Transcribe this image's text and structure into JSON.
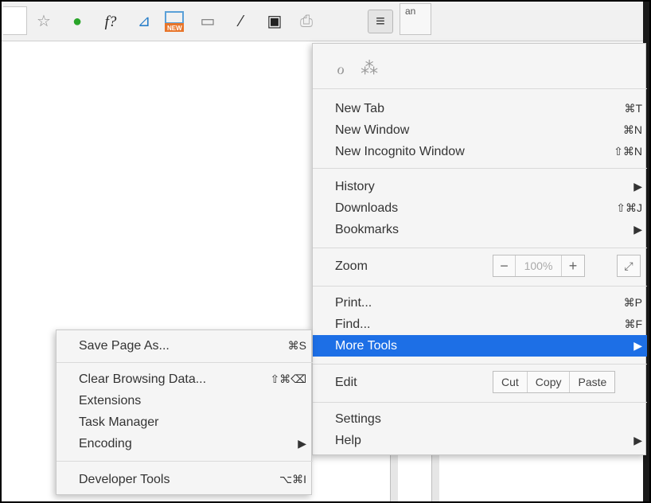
{
  "toolbar": {
    "icons": [
      "star-icon",
      "evernote-icon",
      "fx-icon",
      "satellite-icon",
      "new-badge-icon",
      "message-icon",
      "eyedropper-icon",
      "screenshot-icon",
      "print-icon",
      "menu-icon"
    ],
    "fx_label": "f?",
    "new_badge": "NEW",
    "tab_peek": "an"
  },
  "main_menu": {
    "top_icons": [
      "opera-icon",
      "dropbox-icon"
    ],
    "group1": [
      {
        "label": "New Tab",
        "shortcut": "⌘T"
      },
      {
        "label": "New Window",
        "shortcut": "⌘N"
      },
      {
        "label": "New Incognito Window",
        "shortcut": "⇧⌘N"
      }
    ],
    "group2": [
      {
        "label": "History",
        "shortcut": "▶"
      },
      {
        "label": "Downloads",
        "shortcut": "⇧⌘J"
      },
      {
        "label": "Bookmarks",
        "shortcut": "▶"
      }
    ],
    "zoom": {
      "label": "Zoom",
      "minus": "−",
      "value": "100%",
      "plus": "+",
      "fullscreen": "⤢"
    },
    "group3": [
      {
        "label": "Print...",
        "shortcut": "⌘P"
      },
      {
        "label": "Find...",
        "shortcut": "⌘F"
      },
      {
        "label": "More Tools",
        "shortcut": "▶"
      }
    ],
    "edit": {
      "label": "Edit",
      "cut": "Cut",
      "copy": "Copy",
      "paste": "Paste"
    },
    "group4": [
      {
        "label": "Settings",
        "shortcut": ""
      },
      {
        "label": "Help",
        "shortcut": "▶"
      }
    ]
  },
  "sub_menu": {
    "items": [
      {
        "label": "Save Page As...",
        "shortcut": "⌘S"
      },
      {
        "label": "Clear Browsing Data...",
        "shortcut": "⇧⌘⌫"
      },
      {
        "label": "Extensions",
        "shortcut": ""
      },
      {
        "label": "Task Manager",
        "shortcut": ""
      },
      {
        "label": "Encoding",
        "shortcut": "▶"
      },
      {
        "label": "Developer Tools",
        "shortcut": "⌥⌘I"
      }
    ]
  },
  "colors": {
    "highlight": "#1d6fe6",
    "menu_bg": "#f5f5f5"
  }
}
